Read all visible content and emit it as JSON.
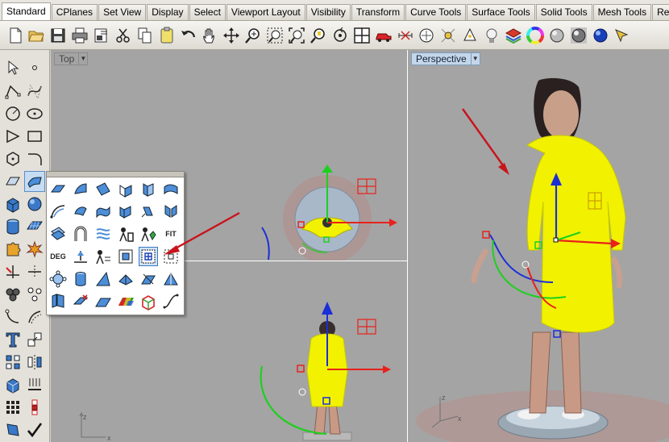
{
  "tabs": [
    {
      "label": "Standard",
      "active": true
    },
    {
      "label": "CPlanes"
    },
    {
      "label": "Set View"
    },
    {
      "label": "Display"
    },
    {
      "label": "Select"
    },
    {
      "label": "Viewport Layout"
    },
    {
      "label": "Visibility"
    },
    {
      "label": "Transform"
    },
    {
      "label": "Curve Tools"
    },
    {
      "label": "Surface Tools"
    },
    {
      "label": "Solid Tools"
    },
    {
      "label": "Mesh Tools"
    },
    {
      "label": "Re"
    }
  ],
  "toolbar_icons": [
    "new-file-icon",
    "open-folder-icon",
    "save-icon",
    "print-icon",
    "import-icon",
    "cut-icon",
    "copy-icon",
    "paste-icon",
    "undo-icon",
    "pan-hand-icon",
    "rotate-view-icon",
    "zoom-icon",
    "zoom-window-icon",
    "zoom-extents-icon",
    "zoom-selected-icon",
    "rotate-camera-icon",
    "four-viewports-icon",
    "car-named-view-icon",
    "dimension-icon",
    "cplane-icon",
    "display-settings-icon",
    "osnap-icon",
    "light-bulb-icon",
    "layer-icon",
    "color-wheel-icon",
    "render-sphere-icon",
    "rendered-sphere-icon",
    "blue-sphere-icon",
    "more-icon"
  ],
  "viewports": {
    "top": {
      "label": "Top",
      "dropdown": "▼"
    },
    "perspective": {
      "label": "Perspective",
      "dropdown": "▼"
    }
  },
  "flyout": {
    "fit_label": "FIT",
    "deg_label": "DEG"
  },
  "colors": {
    "viewport_bg": "#a4a4a4",
    "coat": "#f2f200",
    "gumball_x": "#e8221b",
    "gumball_y": "#1fcf1f",
    "gumball_z": "#1a2fd6",
    "annotation_arrow": "#c8141b"
  }
}
